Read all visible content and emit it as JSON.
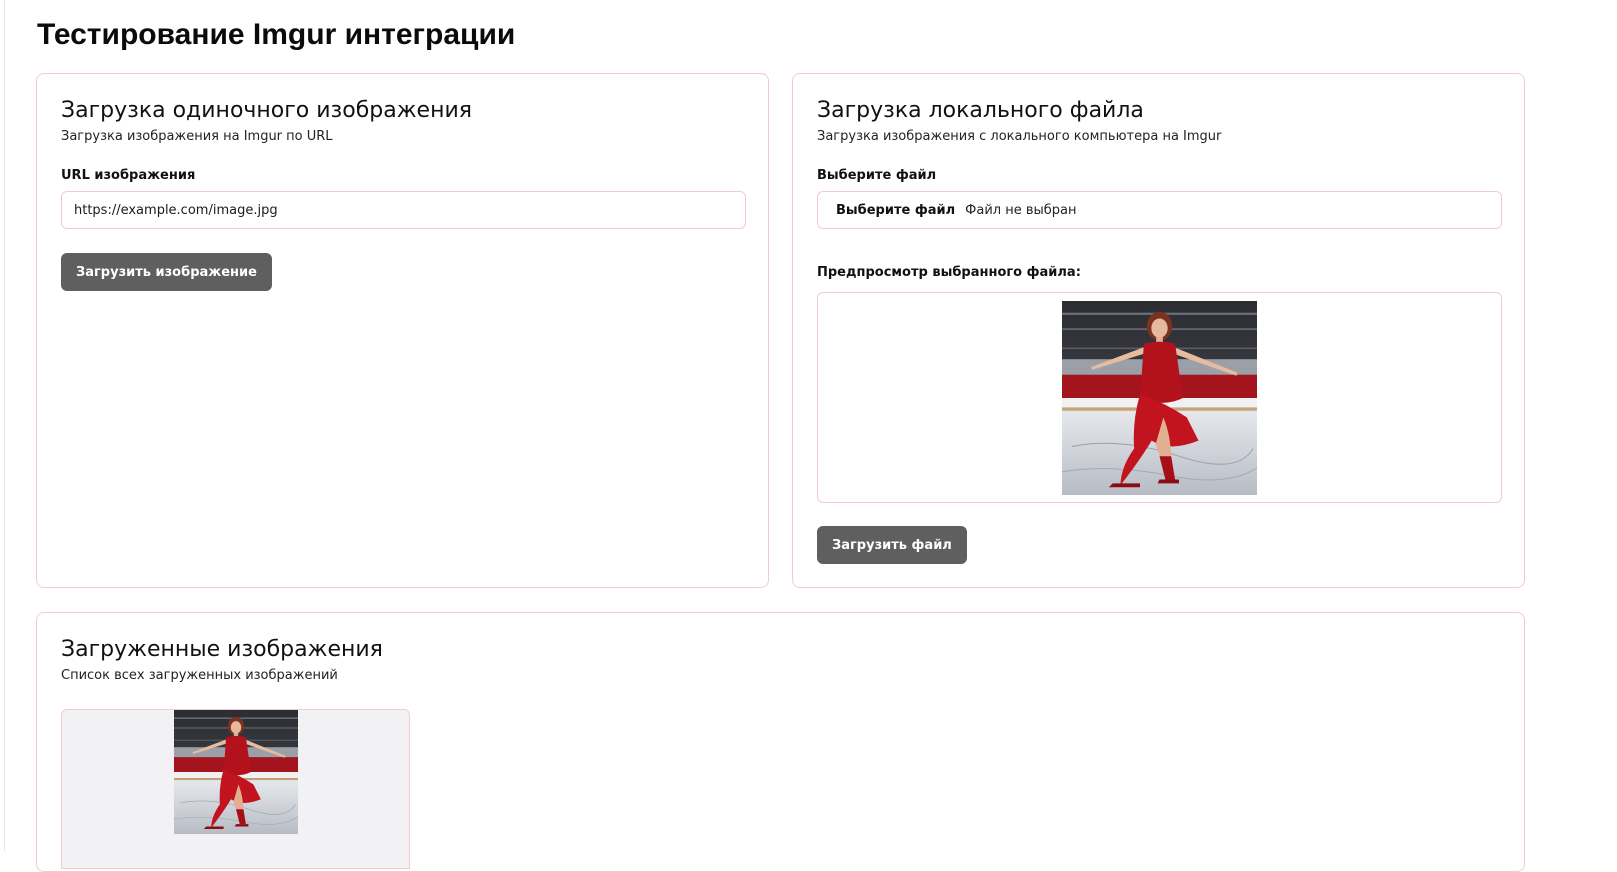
{
  "page": {
    "title": "Тестирование Imgur интеграции"
  },
  "url_upload": {
    "title": "Загрузка одиночного изображения",
    "subtitle": "Загрузка изображения на Imgur по URL",
    "field_label": "URL изображения",
    "url_value": "https://example.com/image.jpg",
    "button_label": "Загрузить изображение"
  },
  "file_upload": {
    "title": "Загрузка локального файла",
    "subtitle": "Загрузка изображения с локального компьютера на Imgur",
    "field_label": "Выберите файл",
    "choose_label": "Выберите файл",
    "file_status": "Файл не выбран",
    "preview_label": "Предпросмотр выбранного файла:",
    "button_label": "Загрузить файл"
  },
  "gallery": {
    "title": "Загруженные изображения",
    "subtitle": "Список всех загруженных изображений"
  },
  "colors": {
    "card_border": "#f3c9d4",
    "button_bg": "#5f5f5f",
    "button_text": "#ffffff",
    "gallery_tile_bg": "#f2f2f4",
    "dress_red": "#b3121c"
  },
  "icons": {
    "preview_image": "figure-skater-photo",
    "gallery_image": "figure-skater-photo"
  }
}
